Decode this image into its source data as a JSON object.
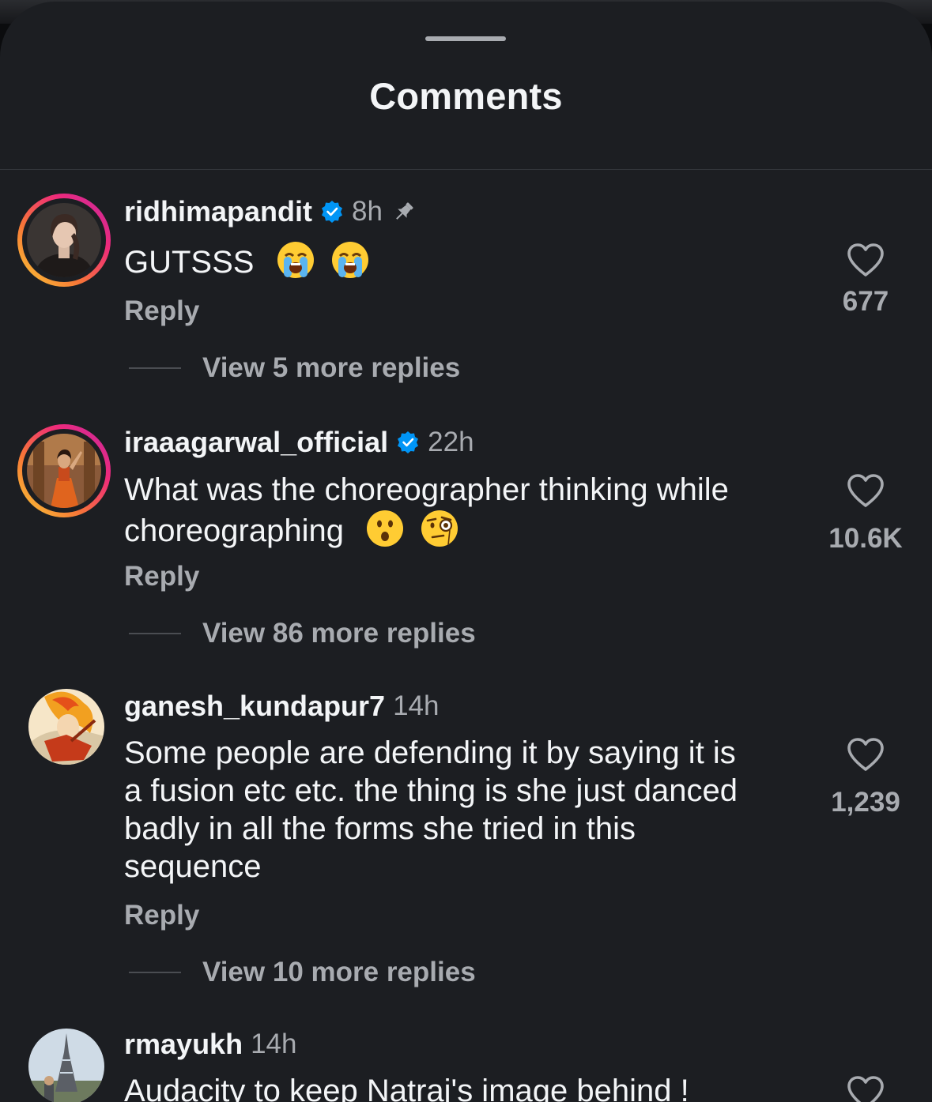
{
  "sheet": {
    "title": "Comments"
  },
  "comments": [
    {
      "username": "ridhimapandit",
      "verified": true,
      "time": "8h",
      "pinned": true,
      "text": "GUTSSS",
      "emojis": [
        "loudly-crying-face",
        "loudly-crying-face"
      ],
      "reply_label": "Reply",
      "likes": "677",
      "view_replies": "View 5 more replies",
      "has_story": true
    },
    {
      "username": "iraaagarwal_official",
      "verified": true,
      "time": "22h",
      "pinned": false,
      "text_lines": [
        "What was the choreographer thinking while",
        "choreographing"
      ],
      "emojis": [
        "hushed-face",
        "face-with-monocle"
      ],
      "reply_label": "Reply",
      "likes": "10.6K",
      "view_replies": "View 86 more replies",
      "has_story": true
    },
    {
      "username": "ganesh_kundapur7",
      "verified": false,
      "time": "14h",
      "pinned": false,
      "text_lines": [
        "Some people are defending it by saying it is",
        "a fusion etc etc. the thing is she just danced",
        "badly in all the forms she tried in this",
        "sequence"
      ],
      "reply_label": "Reply",
      "likes": "1,239",
      "view_replies": "View 10 more replies",
      "has_story": false
    },
    {
      "username": "rmayukh",
      "verified": false,
      "time": "14h",
      "pinned": false,
      "text": "Audacity to keep Natraj's image behind !",
      "has_story": false
    }
  ],
  "colors": {
    "sheet_bg": "#1c1e22",
    "primary_text": "#f3f5f7",
    "secondary_text": "#a8abb0",
    "verified_badge": "#0095f6"
  },
  "icons": {
    "verified": "verified-badge-icon",
    "pin": "pin-icon",
    "like": "heart-outline-icon"
  }
}
